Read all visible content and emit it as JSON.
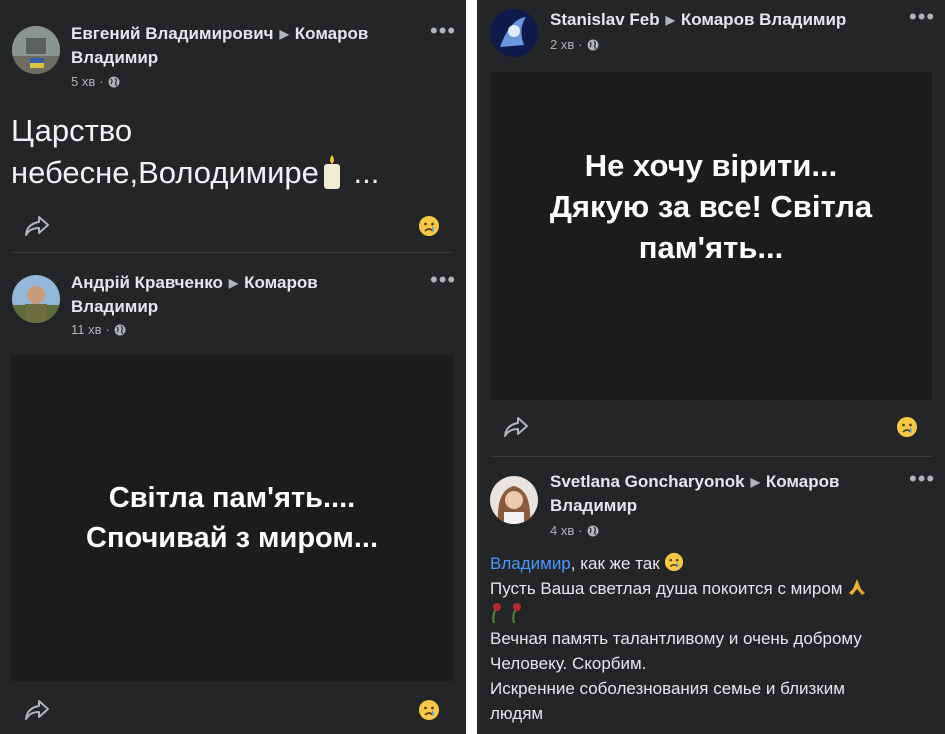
{
  "colors": {
    "background": "#242526",
    "text": "#e4e6eb",
    "muted": "#b0b3b8",
    "mention": "#4599ff",
    "image_bg": "#1c1c1c"
  },
  "left": {
    "post1": {
      "author": "Евгений Владимирович",
      "target": "Комаров",
      "target_line2": "Владимир",
      "time": "5 хв",
      "text_line1": "Царство",
      "text_line2": "небесне,Володимире",
      "text_suffix": "...",
      "reaction_icon": "crying-face-icon"
    },
    "post2": {
      "author": "Андрій Кравченко",
      "target": "Комаров",
      "target_line2": "Владимир",
      "time": "11 хв",
      "image_line1": "Світла пам'ять....",
      "image_line2": "Спочивай з миром...",
      "reaction_icon": "crying-face-icon"
    }
  },
  "right": {
    "post1": {
      "author": "Stanislav Feb",
      "target": "Комаров Владимир",
      "time": "2 хв",
      "image_line1": "Не хочу вірити...",
      "image_line2": "Дякую за все! Світла",
      "image_line3": "пам'ять...",
      "reaction_icon": "crying-face-icon"
    },
    "post2": {
      "author": "Svetlana Goncharyonok",
      "target": "Комаров",
      "target_line2": "Владимир",
      "time": "4 хв",
      "mention": "Владимир",
      "line1_rest": ", как же так",
      "line2": "Пусть Ваша светлая душа покоится с миром",
      "line4": "Вечная память талантливому и очень доброму",
      "line5": "Человеку. Скорбим.",
      "line6": "Искренние соболезнования семье и близким",
      "line7": "людям"
    }
  },
  "icons": {
    "more": "more-dots-icon",
    "share": "share-arrow-icon",
    "privacy": "globe-icon",
    "candle": "candle-icon",
    "pray": "folded-hands-icon",
    "rose": "wilted-rose-icon"
  }
}
